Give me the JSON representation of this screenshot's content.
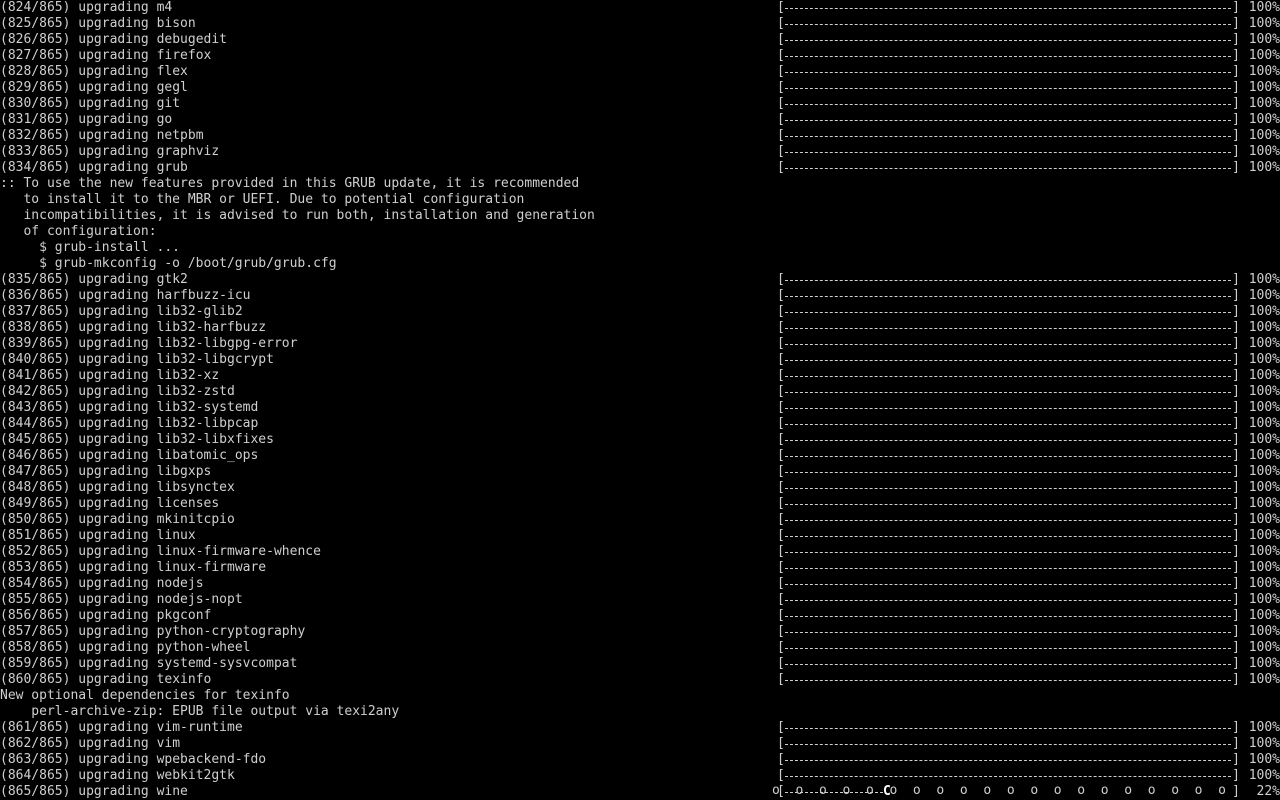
{
  "lines": [
    {
      "kind": "progress",
      "index": "(824/865)",
      "action": "upgrading",
      "package": "m4",
      "progress": 100,
      "percent_text": "100%"
    },
    {
      "kind": "progress",
      "index": "(825/865)",
      "action": "upgrading",
      "package": "bison",
      "progress": 100,
      "percent_text": "100%"
    },
    {
      "kind": "progress",
      "index": "(826/865)",
      "action": "upgrading",
      "package": "debugedit",
      "progress": 100,
      "percent_text": "100%"
    },
    {
      "kind": "progress",
      "index": "(827/865)",
      "action": "upgrading",
      "package": "firefox",
      "progress": 100,
      "percent_text": "100%"
    },
    {
      "kind": "progress",
      "index": "(828/865)",
      "action": "upgrading",
      "package": "flex",
      "progress": 100,
      "percent_text": "100%"
    },
    {
      "kind": "progress",
      "index": "(829/865)",
      "action": "upgrading",
      "package": "gegl",
      "progress": 100,
      "percent_text": "100%"
    },
    {
      "kind": "progress",
      "index": "(830/865)",
      "action": "upgrading",
      "package": "git",
      "progress": 100,
      "percent_text": "100%"
    },
    {
      "kind": "progress",
      "index": "(831/865)",
      "action": "upgrading",
      "package": "go",
      "progress": 100,
      "percent_text": "100%"
    },
    {
      "kind": "progress",
      "index": "(832/865)",
      "action": "upgrading",
      "package": "netpbm",
      "progress": 100,
      "percent_text": "100%"
    },
    {
      "kind": "progress",
      "index": "(833/865)",
      "action": "upgrading",
      "package": "graphviz",
      "progress": 100,
      "percent_text": "100%"
    },
    {
      "kind": "progress",
      "index": "(834/865)",
      "action": "upgrading",
      "package": "grub",
      "progress": 100,
      "percent_text": "100%"
    },
    {
      "kind": "text",
      "text": ":: To use the new features provided in this GRUB update, it is recommended"
    },
    {
      "kind": "text",
      "text": "   to install it to the MBR or UEFI. Due to potential configuration"
    },
    {
      "kind": "text",
      "text": "   incompatibilities, it is advised to run both, installation and generation"
    },
    {
      "kind": "text",
      "text": "   of configuration:"
    },
    {
      "kind": "text",
      "text": "     $ grub-install ..."
    },
    {
      "kind": "text",
      "text": "     $ grub-mkconfig -o /boot/grub/grub.cfg"
    },
    {
      "kind": "progress",
      "index": "(835/865)",
      "action": "upgrading",
      "package": "gtk2",
      "progress": 100,
      "percent_text": "100%"
    },
    {
      "kind": "progress",
      "index": "(836/865)",
      "action": "upgrading",
      "package": "harfbuzz-icu",
      "progress": 100,
      "percent_text": "100%"
    },
    {
      "kind": "progress",
      "index": "(837/865)",
      "action": "upgrading",
      "package": "lib32-glib2",
      "progress": 100,
      "percent_text": "100%"
    },
    {
      "kind": "progress",
      "index": "(838/865)",
      "action": "upgrading",
      "package": "lib32-harfbuzz",
      "progress": 100,
      "percent_text": "100%"
    },
    {
      "kind": "progress",
      "index": "(839/865)",
      "action": "upgrading",
      "package": "lib32-libgpg-error",
      "progress": 100,
      "percent_text": "100%"
    },
    {
      "kind": "progress",
      "index": "(840/865)",
      "action": "upgrading",
      "package": "lib32-libgcrypt",
      "progress": 100,
      "percent_text": "100%"
    },
    {
      "kind": "progress",
      "index": "(841/865)",
      "action": "upgrading",
      "package": "lib32-xz",
      "progress": 100,
      "percent_text": "100%"
    },
    {
      "kind": "progress",
      "index": "(842/865)",
      "action": "upgrading",
      "package": "lib32-zstd",
      "progress": 100,
      "percent_text": "100%"
    },
    {
      "kind": "progress",
      "index": "(843/865)",
      "action": "upgrading",
      "package": "lib32-systemd",
      "progress": 100,
      "percent_text": "100%"
    },
    {
      "kind": "progress",
      "index": "(844/865)",
      "action": "upgrading",
      "package": "lib32-libpcap",
      "progress": 100,
      "percent_text": "100%"
    },
    {
      "kind": "progress",
      "index": "(845/865)",
      "action": "upgrading",
      "package": "lib32-libxfixes",
      "progress": 100,
      "percent_text": "100%"
    },
    {
      "kind": "progress",
      "index": "(846/865)",
      "action": "upgrading",
      "package": "libatomic_ops",
      "progress": 100,
      "percent_text": "100%"
    },
    {
      "kind": "progress",
      "index": "(847/865)",
      "action": "upgrading",
      "package": "libgxps",
      "progress": 100,
      "percent_text": "100%"
    },
    {
      "kind": "progress",
      "index": "(848/865)",
      "action": "upgrading",
      "package": "libsynctex",
      "progress": 100,
      "percent_text": "100%"
    },
    {
      "kind": "progress",
      "index": "(849/865)",
      "action": "upgrading",
      "package": "licenses",
      "progress": 100,
      "percent_text": "100%"
    },
    {
      "kind": "progress",
      "index": "(850/865)",
      "action": "upgrading",
      "package": "mkinitcpio",
      "progress": 100,
      "percent_text": "100%"
    },
    {
      "kind": "progress",
      "index": "(851/865)",
      "action": "upgrading",
      "package": "linux",
      "progress": 100,
      "percent_text": "100%"
    },
    {
      "kind": "progress",
      "index": "(852/865)",
      "action": "upgrading",
      "package": "linux-firmware-whence",
      "progress": 100,
      "percent_text": "100%"
    },
    {
      "kind": "progress",
      "index": "(853/865)",
      "action": "upgrading",
      "package": "linux-firmware",
      "progress": 100,
      "percent_text": "100%"
    },
    {
      "kind": "progress",
      "index": "(854/865)",
      "action": "upgrading",
      "package": "nodejs",
      "progress": 100,
      "percent_text": "100%"
    },
    {
      "kind": "progress",
      "index": "(855/865)",
      "action": "upgrading",
      "package": "nodejs-nopt",
      "progress": 100,
      "percent_text": "100%"
    },
    {
      "kind": "progress",
      "index": "(856/865)",
      "action": "upgrading",
      "package": "pkgconf",
      "progress": 100,
      "percent_text": "100%"
    },
    {
      "kind": "progress",
      "index": "(857/865)",
      "action": "upgrading",
      "package": "python-cryptography",
      "progress": 100,
      "percent_text": "100%"
    },
    {
      "kind": "progress",
      "index": "(858/865)",
      "action": "upgrading",
      "package": "python-wheel",
      "progress": 100,
      "percent_text": "100%"
    },
    {
      "kind": "progress",
      "index": "(859/865)",
      "action": "upgrading",
      "package": "systemd-sysvcompat",
      "progress": 100,
      "percent_text": "100%"
    },
    {
      "kind": "progress",
      "index": "(860/865)",
      "action": "upgrading",
      "package": "texinfo",
      "progress": 100,
      "percent_text": "100%"
    },
    {
      "kind": "text",
      "text": "New optional dependencies for texinfo"
    },
    {
      "kind": "text",
      "text": "    perl-archive-zip: EPUB file output via texi2any"
    },
    {
      "kind": "progress",
      "index": "(861/865)",
      "action": "upgrading",
      "package": "vim-runtime",
      "progress": 100,
      "percent_text": "100%"
    },
    {
      "kind": "progress",
      "index": "(862/865)",
      "action": "upgrading",
      "package": "vim",
      "progress": 100,
      "percent_text": "100%"
    },
    {
      "kind": "progress",
      "index": "(863/865)",
      "action": "upgrading",
      "package": "wpebackend-fdo",
      "progress": 100,
      "percent_text": "100%"
    },
    {
      "kind": "progress",
      "index": "(864/865)",
      "action": "upgrading",
      "package": "webkit2gtk",
      "progress": 100,
      "percent_text": "100%"
    },
    {
      "kind": "progress",
      "index": "(865/865)",
      "action": "upgrading",
      "package": "wine",
      "progress": 22,
      "percent_text": "22%",
      "pacman": "C",
      "dots": "o  o  o  o  o  o  o  o  o  o  o  o  o  o  o  o  o  o  o  o"
    }
  ],
  "colors": {
    "background": "#000000",
    "foreground": "#cfcfcf"
  }
}
